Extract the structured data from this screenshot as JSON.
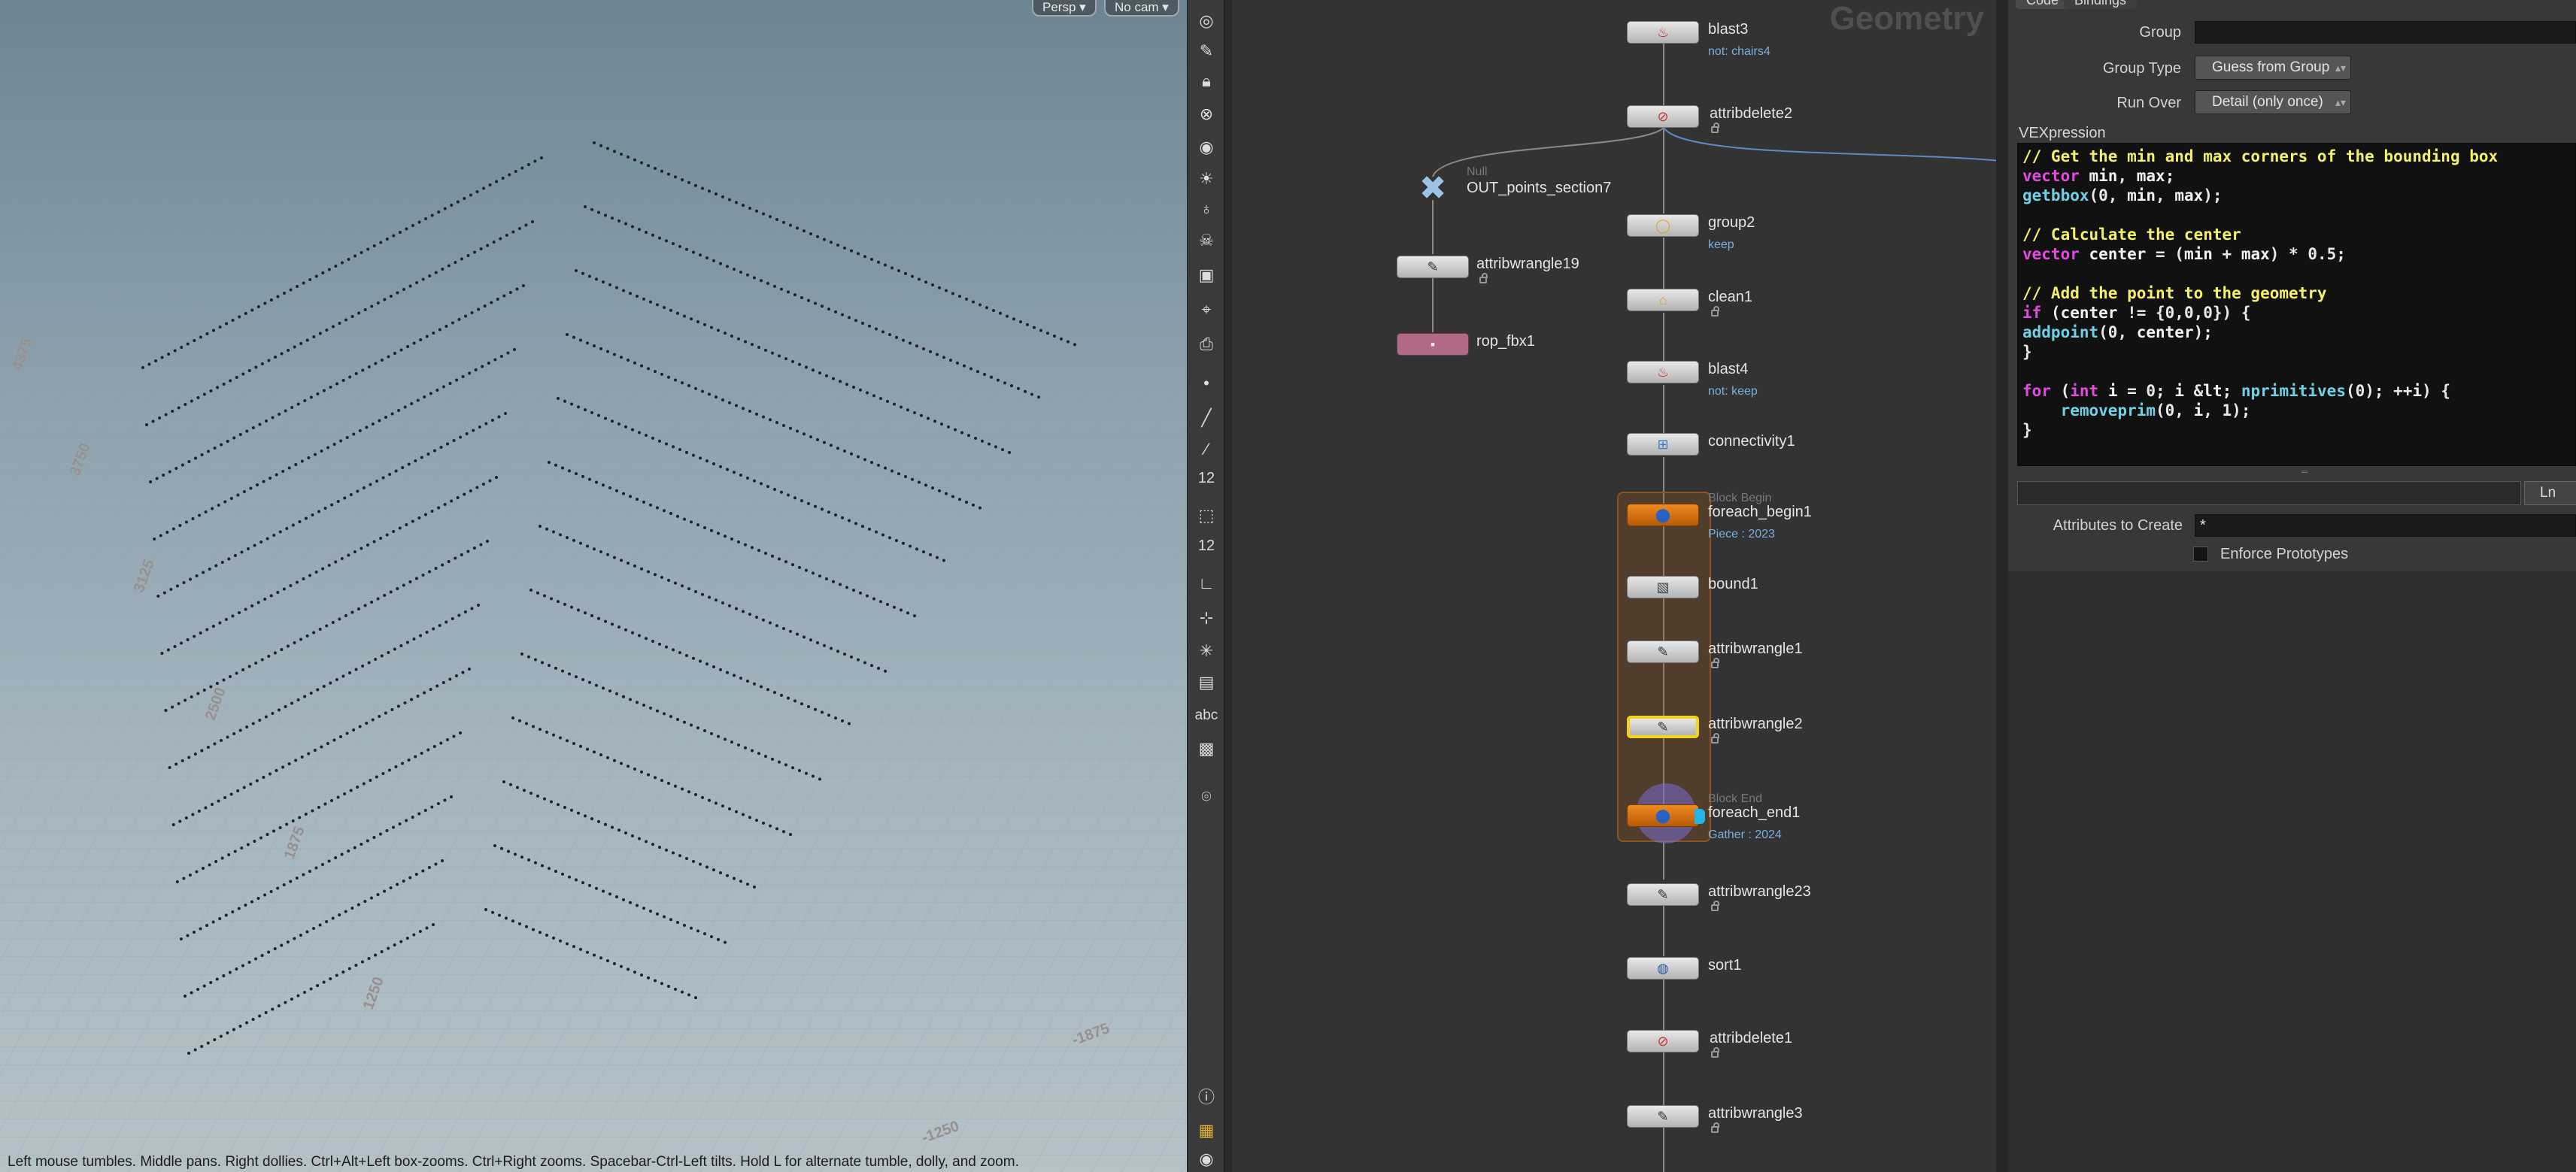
{
  "viewport": {
    "persp_label": "Persp",
    "cam_label": "No cam",
    "status_text": "Left mouse tumbles. Middle pans. Right dollies. Ctrl+Alt+Left box-zooms. Ctrl+Right zooms. Spacebar-Ctrl-Left tilts. Hold L for alternate tumble, dolly, and zoom.",
    "axis_labels": [
      "-1875",
      "-1250",
      "1250",
      "1875",
      "2500",
      "3125",
      "3750",
      "4375"
    ]
  },
  "toolbar": {
    "icons": [
      "view-mode-icon",
      "select-icon",
      "lock-icon",
      "ghost-icon",
      "snapshot-icon",
      "light-icon",
      "bulb-icon",
      "skull-icon",
      "camera-icon",
      "handle-icon",
      "capture-icon",
      "point-icon",
      "brush-icon",
      "picker-icon",
      "count-icon",
      "measure-icon",
      "count2-icon",
      "ruler-icon",
      "snap-icon",
      "node-icon",
      "display-icon",
      "text-icon",
      "background-icon",
      "location-icon",
      "info-icon",
      "layout-icon",
      "visibility-icon"
    ],
    "number_1": "12",
    "number_2": "12",
    "text_label": "abc"
  },
  "network": {
    "title": "Geometry",
    "nodes": [
      {
        "name": "blast3",
        "sub": "not: chairs4"
      },
      {
        "name": "attribdelete2",
        "sub": ""
      },
      {
        "name": "OUT_points_section7",
        "type": "Null"
      },
      {
        "name": "group2",
        "sub": "keep"
      },
      {
        "name": "attribwrangle19",
        "sub": ""
      },
      {
        "name": "clean1",
        "sub": ""
      },
      {
        "name": "rop_fbx1",
        "sub": ""
      },
      {
        "name": "blast4",
        "sub": "not: keep"
      },
      {
        "name": "connectivity1",
        "sub": ""
      },
      {
        "name": "foreach_begin1",
        "type": "Block Begin",
        "sub": "Piece : 2023"
      },
      {
        "name": "bound1",
        "sub": ""
      },
      {
        "name": "attribwrangle1",
        "sub": ""
      },
      {
        "name": "attribwrangle2",
        "sub": ""
      },
      {
        "name": "foreach_end1",
        "type": "Block End",
        "sub": "Gather : 2024"
      },
      {
        "name": "attribwrangle23",
        "sub": ""
      },
      {
        "name": "sort1",
        "sub": ""
      },
      {
        "name": "attribdelete1",
        "sub": ""
      },
      {
        "name": "attribwrangle3",
        "sub": ""
      }
    ]
  },
  "params": {
    "tabs": [
      "Code",
      "Bindings"
    ],
    "group_label": "Group",
    "group_value": "",
    "group_type_label": "Group Type",
    "group_type_value": "Guess from Group",
    "run_over_label": "Run Over",
    "run_over_value": "Detail (only once)",
    "vex_label": "VEXpression",
    "code_lines": [
      "// Get the min and max corners of the bounding box",
      "vector min, max;",
      "getbbox(0, min, max);",
      "",
      "// Calculate the center",
      "vector center = (min + max) * 0.5;",
      "",
      "// Add the point to the geometry",
      "if (center != {0,0,0}) {",
      "addpoint(0, center);",
      "}",
      "",
      "for (int i = 0; i < nprimitives(0); ++i) {",
      "    removeprim(0, i, 1);",
      "}"
    ],
    "ln_label": "Ln",
    "attrs_label": "Attributes to Create",
    "attrs_value": "*",
    "enforce_label": "Enforce Prototypes"
  }
}
